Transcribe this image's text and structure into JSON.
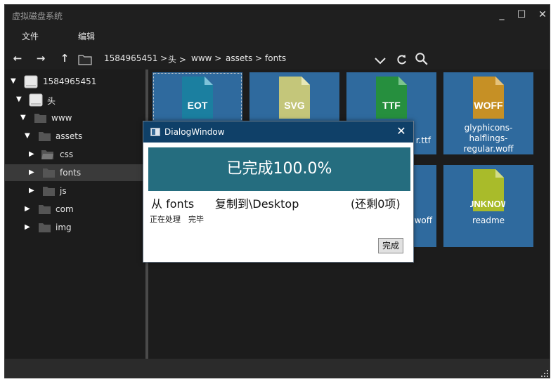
{
  "window": {
    "title": "虚拟磁盘系统",
    "controls": {
      "minimize": "_",
      "maximize": "☐",
      "close": "✕"
    }
  },
  "menu": {
    "items": [
      "文件",
      "编辑"
    ]
  },
  "toolbar": {
    "breadcrumbs": [
      "1584965451 >",
      "头 >",
      "www >",
      "assets >",
      "fonts"
    ],
    "icons": [
      "arrow-left-icon",
      "arrow-right-icon",
      "arrow-up-icon",
      "folder-icon",
      "chevron-down-icon",
      "refresh-icon",
      "search-icon"
    ]
  },
  "tree": {
    "items": [
      {
        "label": "1584965451",
        "arrow": "▼",
        "icon": "drive-icon"
      },
      {
        "label": "头",
        "arrow": "▼",
        "icon": "drive-icon"
      },
      {
        "label": "www",
        "arrow": "▼",
        "icon": "folder-icon"
      },
      {
        "label": "assets",
        "arrow": "▼",
        "icon": "folder-icon"
      },
      {
        "label": "css",
        "arrow": "▶",
        "icon": "folder-open-icon"
      },
      {
        "label": "fonts",
        "arrow": "▶",
        "icon": "folder-icon",
        "selected": true
      },
      {
        "label": "js",
        "arrow": "▶",
        "icon": "folder-icon"
      },
      {
        "label": "com",
        "arrow": "▶",
        "icon": "folder-icon"
      },
      {
        "label": "img",
        "arrow": "▶",
        "icon": "folder-icon"
      }
    ]
  },
  "files": [
    {
      "type": "EOT",
      "name": "",
      "color": "#1b7fa0"
    },
    {
      "type": "SVG",
      "name": "",
      "color": "#c4c67a"
    },
    {
      "type": "TTF",
      "name": "r.ttf",
      "color": "#268f3e"
    },
    {
      "type": "WOFF",
      "name": "glyphicons-halflings-regular.woff",
      "color": "#c69025"
    },
    {
      "type": "",
      "name": "",
      "color": "#2f6a9e"
    },
    {
      "type": "",
      "name": "",
      "color": "#2f6a9e"
    },
    {
      "type": "",
      "name": "woff",
      "color": "#2f6a9e"
    },
    {
      "type": "UNKNOW",
      "name": "readme",
      "color": "#a9bb2a"
    }
  ],
  "dialog": {
    "title": "DialogWindow",
    "progress_text": "已完成100.0%",
    "progress_fraction": 1.0,
    "from_label": "从 fonts",
    "to_label": "复制到\\Desktop",
    "remaining_label": "(还剩0项)",
    "status_label": "正在处理",
    "status_value": "完毕",
    "button_label": "完成"
  },
  "colors": {
    "background": "#1f1f1f",
    "tile": "#2f6a9e",
    "dialog_title": "#0f4068",
    "progress": "#256d7f"
  }
}
